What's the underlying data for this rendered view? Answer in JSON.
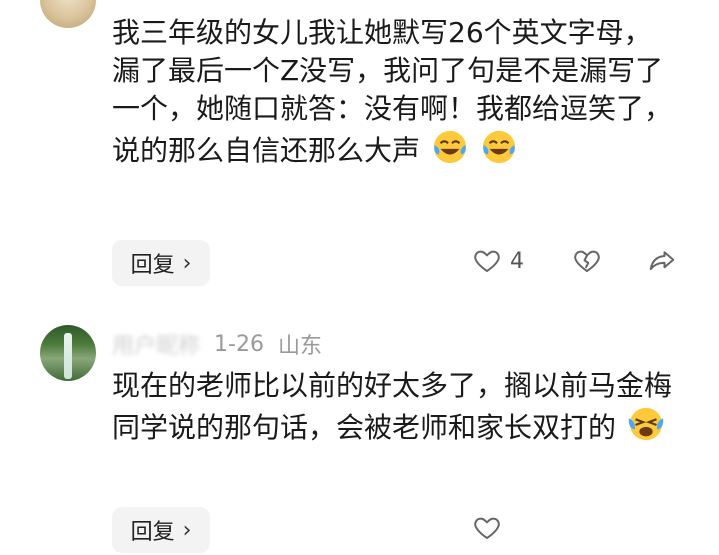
{
  "comments": [
    {
      "text": "我三年级的女儿我让她默写26个英文字母，漏了最后一个Z没写，我问了句是不是漏写了一个，她随口就答：没有啊！我都给逗笑了，说的那么自信还那么大声",
      "emojis": [
        "laugh-cry-emoji",
        "laugh-cry-emoji"
      ],
      "reply_label": "回复",
      "like_count": "4"
    },
    {
      "author": "用户昵称",
      "date": "1-26",
      "location": "山东",
      "text": "现在的老师比以前的好太多了，搁以前马金梅同学说的那句话，会被老师和家长双打的",
      "emojis": [
        "crying-laugh-emoji"
      ],
      "reply_label": "回复"
    }
  ]
}
